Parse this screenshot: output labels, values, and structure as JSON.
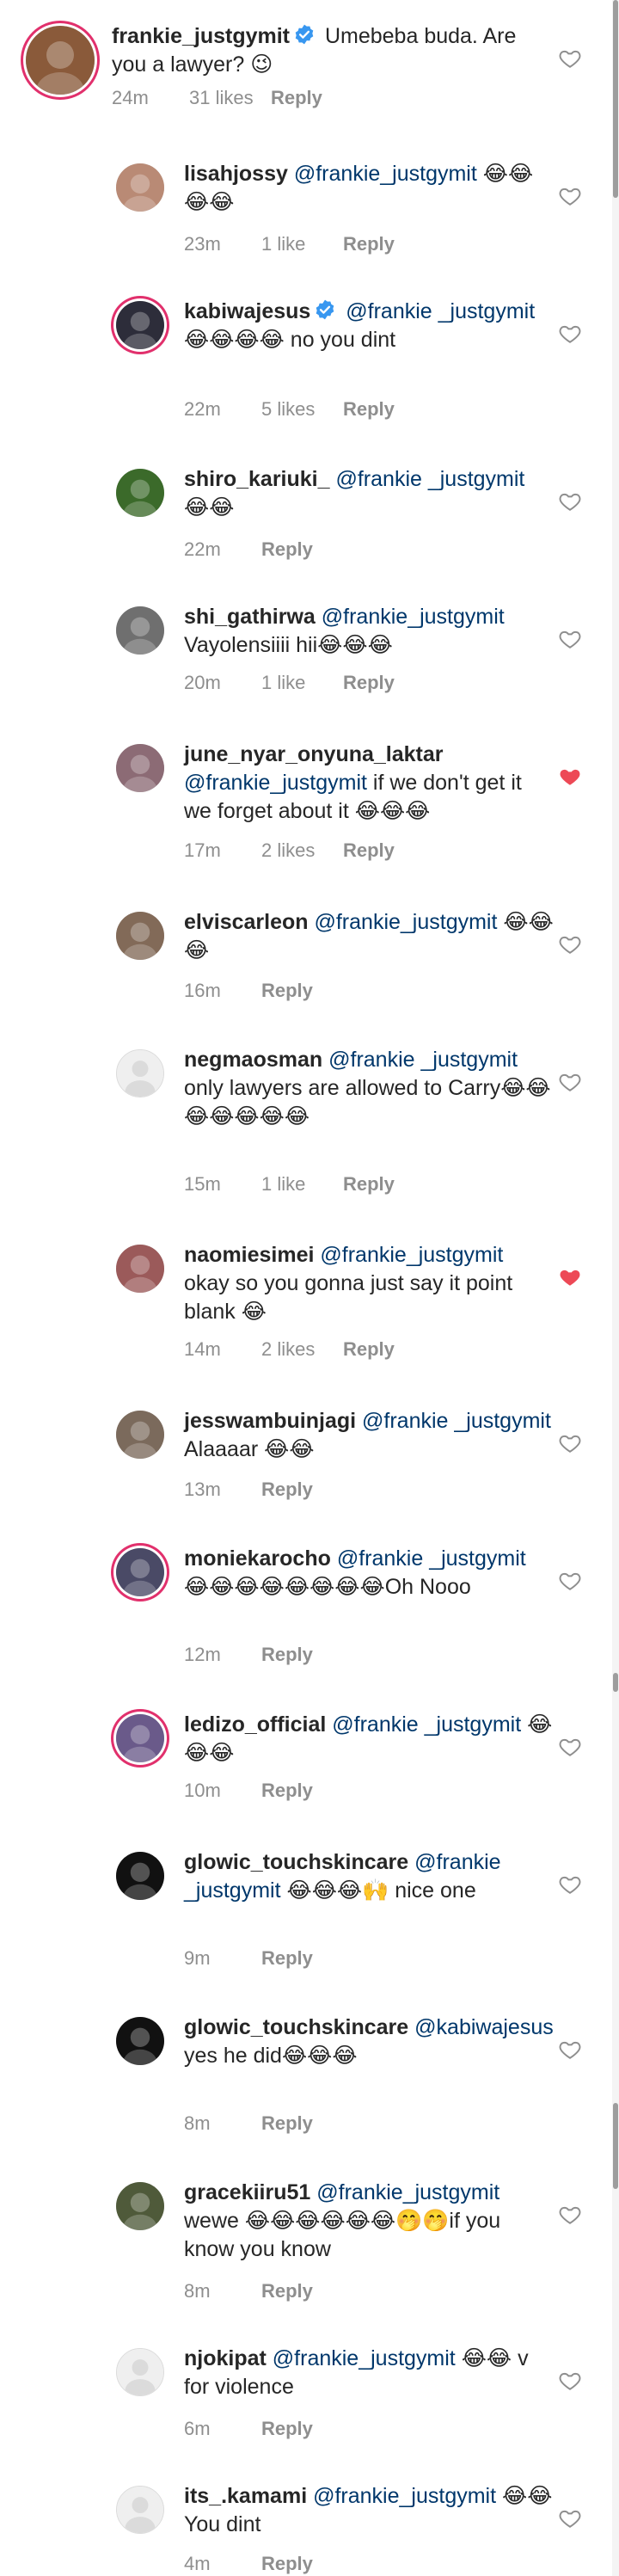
{
  "colors": {
    "accent": "#e1306c",
    "mention": "#00376b",
    "liked": "#ed4956",
    "muted": "#8e8e8e"
  },
  "comments": [
    {
      "username": "frankie_justgymit",
      "verified": true,
      "prefix": " ",
      "mention": "",
      "body": "Umebeba buda. Are you a lawyer? 😉",
      "time": "24m",
      "likes": "31 likes",
      "reply": "Reply",
      "liked": false
    },
    {
      "username": "lisahjossy",
      "verified": false,
      "prefix": " ",
      "mention": "@frankie_justgymit",
      "body": " 😂😂😂😂",
      "time": "23m",
      "likes": "1 like",
      "reply": "Reply",
      "liked": false
    },
    {
      "username": "kabiwajesus",
      "verified": true,
      "prefix": " ",
      "mention": "@frankie _justgymit",
      "body": " 😂😂😂😂 no you dint",
      "time": "22m",
      "likes": "5 likes",
      "reply": "Reply",
      "liked": false
    },
    {
      "username": "shiro_kariuki_",
      "verified": false,
      "prefix": " ",
      "mention": "@frankie _justgymit",
      "body": " 😂😂",
      "time": "22m",
      "likes": "",
      "reply": "Reply",
      "liked": false
    },
    {
      "username": "shi_gathirwa",
      "verified": false,
      "prefix": " ",
      "mention": "@frankie_justgymit",
      "body": " Vayolensiiii hii😂😂😂",
      "time": "20m",
      "likes": "1 like",
      "reply": "Reply",
      "liked": false
    },
    {
      "username": "june_nyar_onyuna_laktar",
      "verified": false,
      "prefix": " ",
      "mention": "@frankie_justgymit",
      "body": " if we don't get it we forget about it 😂😂😂",
      "time": "17m",
      "likes": "2 likes",
      "reply": "Reply",
      "liked": true
    },
    {
      "username": "elviscarleon",
      "verified": false,
      "prefix": " ",
      "mention": "@frankie_justgymit",
      "body": " 😂😂😂",
      "time": "16m",
      "likes": "",
      "reply": "Reply",
      "liked": false
    },
    {
      "username": "negmaosman",
      "verified": false,
      "prefix": " ",
      "mention": "@frankie _justgymit",
      "body": " only lawyers are allowed to Carry😂😂😂😂😂😂😂",
      "time": "15m",
      "likes": "1 like",
      "reply": "Reply",
      "liked": false
    },
    {
      "username": "naomiesimei",
      "verified": false,
      "prefix": " ",
      "mention": "@frankie_justgymit",
      "body": " okay so you gonna just say it point blank 😂",
      "time": "14m",
      "likes": "2 likes",
      "reply": "Reply",
      "liked": true
    },
    {
      "username": "jesswambuinjagi",
      "verified": false,
      "prefix": " ",
      "mention": "@frankie _justgymit",
      "body": " Alaaaar 😂😂",
      "time": "13m",
      "likes": "",
      "reply": "Reply",
      "liked": false
    },
    {
      "username": "moniekarocho",
      "verified": false,
      "prefix": " ",
      "mention": "@frankie _justgymit",
      "body": " 😂😂😂😂😂😂😂😂Oh Nooo",
      "time": "12m",
      "likes": "",
      "reply": "Reply",
      "liked": false
    },
    {
      "username": "ledizo_official",
      "verified": false,
      "prefix": " ",
      "mention": "@frankie _justgymit",
      "body": " 😂😂😂",
      "time": "10m",
      "likes": "",
      "reply": "Reply",
      "liked": false
    },
    {
      "username": "glowic_touchskincare",
      "verified": false,
      "prefix": " ",
      "mention": "@frankie _justgymit",
      "body": " 😂😂😂🙌 nice one",
      "time": "9m",
      "likes": "",
      "reply": "Reply",
      "liked": false
    },
    {
      "username": "glowic_touchskincare",
      "verified": false,
      "prefix": " ",
      "mention": "@kabiwajesus",
      "body": " yes he did😂😂😂",
      "time": "8m",
      "likes": "",
      "reply": "Reply",
      "liked": false
    },
    {
      "username": "gracekiiru51",
      "verified": false,
      "prefix": " ",
      "mention": "@frankie_justgymit",
      "body": " wewe 😂😂😂😂😂😂🤭🤭if you know you know",
      "time": "8m",
      "likes": "",
      "reply": "Reply",
      "liked": false
    },
    {
      "username": "njokipat",
      "verified": false,
      "prefix": " ",
      "mention": "@frankie_justgymit",
      "body": " 😂😂 v for violence",
      "time": "6m",
      "likes": "",
      "reply": "Reply",
      "liked": false
    },
    {
      "username": "its_.kamami",
      "verified": false,
      "prefix": " ",
      "mention": "@frankie_justgymit",
      "body": " 😂😂 You dint",
      "time": "4m",
      "likes": "",
      "reply": "Reply",
      "liked": false
    }
  ],
  "icons": {
    "like": "heart-icon",
    "verified": "verified-badge-icon",
    "avatar": "avatar-icon"
  }
}
